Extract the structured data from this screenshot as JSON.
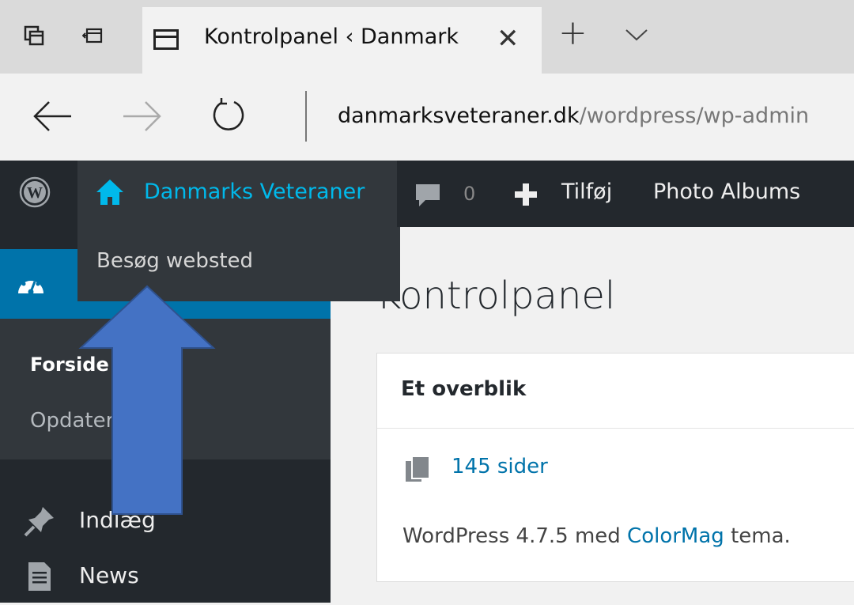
{
  "browser": {
    "tab_title": "Kontrolpanel ‹ Danmark",
    "tab_close_glyph": "✕",
    "new_tab_glyph": "+",
    "url_host": "danmarksveteraner.dk",
    "url_path": "/wordpress/wp-admin"
  },
  "adminbar": {
    "site_name": "Danmarks Veteraner",
    "comments_count": "0",
    "add_label": "Tilføj",
    "photo_albums": "Photo Albums"
  },
  "dropdown": {
    "visit_site": "Besøg websted"
  },
  "sidebar": {
    "submenu_forside": "Forside",
    "submenu_opdateringer": "Opdateringer",
    "items": [
      {
        "label": "Indlæg"
      },
      {
        "label": "News"
      }
    ]
  },
  "content": {
    "page_title": "Kontrolpanel",
    "panel_title": "Et overblik",
    "pages_count": "145 sider",
    "version_prefix": "WordPress 4.7.5 med ",
    "theme_name": "ColorMag",
    "version_suffix": " tema."
  },
  "colors": {
    "adminbar_bg": "#23282d",
    "submenu_bg": "#32373c",
    "accent_blue": "#0073aa",
    "link_cyan": "#00b9eb",
    "annotation_arrow": "#4472c4"
  }
}
